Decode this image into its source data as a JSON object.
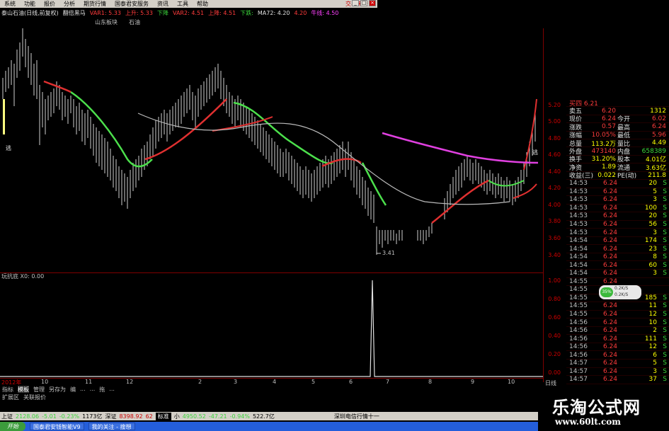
{
  "menu": [
    "系统",
    "功能",
    "报价",
    "分析",
    "期货行情",
    "国泰君安服务",
    "资讯",
    "工具",
    "帮助"
  ],
  "trade_link": "交易未登",
  "title": {
    "stock": "泰山石油(日线,前复权)",
    "formula": "翻倍黑马",
    "var1": "VAR1: 5.33",
    "shang": "上升: 5.33",
    "xia": "下降",
    "var2": "VAR2: 4.51",
    "shangjiang": "上降: 4.51",
    "xiajiang": "下跌:",
    "ma72": "MA72: 4.20",
    "v420": "4.20",
    "niuxian": "牛线: 4.50"
  },
  "sub_tags": [
    "山东板块",
    "石油"
  ],
  "chart": {
    "low_label": "3.41",
    "marker_left": "逃",
    "marker_right": "逃"
  },
  "y_axis_labels": [
    "5.20",
    "5.00",
    "4.80",
    "4.60",
    "4.40",
    "4.20",
    "4.00",
    "3.80",
    "3.60",
    "3.40",
    "1.00",
    "0.80",
    "0.60",
    "0.40",
    "0.20",
    "0.00"
  ],
  "indicator_title": "玩抗底 X0: 0.00",
  "x_axis_labels": [
    "2012年",
    "10",
    "11",
    "12",
    "2",
    "3",
    "4",
    "5",
    "6",
    "7",
    "8",
    "9",
    "10"
  ],
  "tabs": [
    "指标",
    "模板",
    "管理",
    "另存为",
    "编",
    "...",
    "...",
    "拖",
    "..."
  ],
  "tabs2": [
    "扩展区",
    "关联报价"
  ],
  "quote_panel": {
    "header": "买四 6.21",
    "rows": [
      {
        "l": "卖五",
        "v": "6.20",
        "r": "",
        "rv": "1312"
      },
      {
        "l": "现价",
        "v": "6.24",
        "r": "今开",
        "rv": "6.02"
      },
      {
        "l": "涨跌",
        "v": "0.57",
        "r": "最高",
        "rv": "6.24"
      },
      {
        "l": "涨幅",
        "v": "10.05%",
        "r": "最低",
        "rv": "5.96"
      },
      {
        "l": "总量",
        "v": "113.2万",
        "r": "量比",
        "rv": "4.49"
      },
      {
        "l": "外盘",
        "v": "473140",
        "r": "内盘",
        "rv": "658389"
      },
      {
        "l": "换手",
        "v": "31.20%",
        "r": "股本",
        "rv": "4.01亿"
      },
      {
        "l": "净资",
        "v": "1.89",
        "r": "流通",
        "rv": "3.63亿"
      },
      {
        "l": "收益(三)",
        "v": "0.022",
        "r": "PE(动)",
        "rv": "211.8"
      }
    ]
  },
  "ticks": [
    {
      "t": "14:53",
      "p": "6.24",
      "v": "20",
      "s": "S"
    },
    {
      "t": "14:53",
      "p": "6.24",
      "v": "5",
      "s": "S"
    },
    {
      "t": "14:53",
      "p": "6.24",
      "v": "3",
      "s": "S"
    },
    {
      "t": "14:53",
      "p": "6.24",
      "v": "100",
      "s": "S"
    },
    {
      "t": "14:53",
      "p": "6.24",
      "v": "20",
      "s": "S"
    },
    {
      "t": "14:53",
      "p": "6.24",
      "v": "56",
      "s": "S"
    },
    {
      "t": "14:53",
      "p": "6.24",
      "v": "3",
      "s": "S"
    },
    {
      "t": "14:54",
      "p": "6.24",
      "v": "174",
      "s": "S"
    },
    {
      "t": "14:54",
      "p": "6.24",
      "v": "23",
      "s": "S"
    },
    {
      "t": "14:54",
      "p": "6.24",
      "v": "8",
      "s": "S"
    },
    {
      "t": "14:54",
      "p": "6.24",
      "v": "60",
      "s": "S"
    },
    {
      "t": "14:54",
      "p": "6.24",
      "v": "3",
      "s": "S"
    },
    {
      "t": "14:55",
      "p": "6.24",
      "v": "",
      "s": ""
    },
    {
      "t": "14:55",
      "p": "6.24",
      "v": "",
      "s": ""
    },
    {
      "t": "14:55",
      "p": "6.24",
      "v": "185",
      "s": "S"
    },
    {
      "t": "14:55",
      "p": "6.24",
      "v": "11",
      "s": "S"
    },
    {
      "t": "14:55",
      "p": "6.24",
      "v": "12",
      "s": "S"
    },
    {
      "t": "14:56",
      "p": "6.24",
      "v": "10",
      "s": "S"
    },
    {
      "t": "14:56",
      "p": "6.24",
      "v": "2",
      "s": "S"
    },
    {
      "t": "14:56",
      "p": "6.24",
      "v": "111",
      "s": "S"
    },
    {
      "t": "14:56",
      "p": "6.24",
      "v": "12",
      "s": "S"
    },
    {
      "t": "14:56",
      "p": "6.24",
      "v": "6",
      "s": "S"
    },
    {
      "t": "14:57",
      "p": "6.24",
      "v": "5",
      "s": "S"
    },
    {
      "t": "14:57",
      "p": "6.24",
      "v": "3",
      "s": "S"
    },
    {
      "t": "14:57",
      "p": "6.24",
      "v": "37",
      "s": "S"
    }
  ],
  "badge": {
    "pct": "35%",
    "up": "0.2K/S",
    "down": "0.2K/S"
  },
  "right_tab": "日线",
  "status": {
    "sh_label": "上证",
    "sh_val": "2128.06",
    "sh_chg": "-5.01",
    "sh_pct": "-0.23%",
    "sh_amt": "1173亿",
    "sz_label": "深证",
    "sz_val": "8398.92",
    "sz_chg": "62",
    "std": "标准",
    "zx_label": "小",
    "zx_val": "4950.52",
    "zx_chg": "-47.21",
    "zx_pct": "-0.94%",
    "zx_amt": "522.7亿",
    "ticker": "深圳电信行情十一"
  },
  "taskbar": {
    "start": "开始",
    "tasks": [
      "国泰君安钱智能V9",
      "我的关注 - 搜想"
    ]
  },
  "watermark": {
    "line1": "乐淘公式网",
    "line2": "www.60lt.com"
  }
}
